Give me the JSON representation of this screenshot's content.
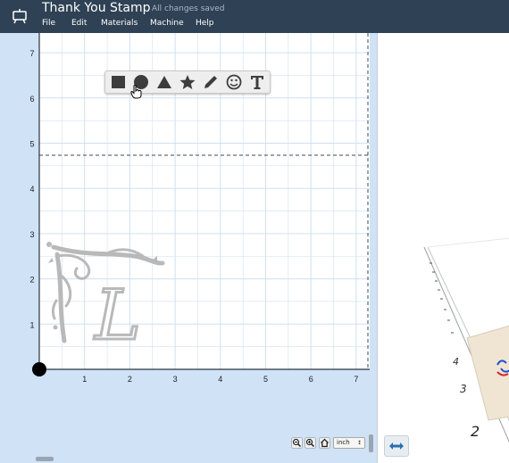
{
  "app": {
    "icon": "robot-icon",
    "title": "Thank You Stamp",
    "save_status": "All changes saved"
  },
  "menu": [
    {
      "label": "File"
    },
    {
      "label": "Edit"
    },
    {
      "label": "Materials"
    },
    {
      "label": "Machine"
    },
    {
      "label": "Help"
    }
  ],
  "toolbar": {
    "tools": [
      {
        "name": "rectangle-tool",
        "icon": "square-icon"
      },
      {
        "name": "circle-tool",
        "icon": "circle-icon"
      },
      {
        "name": "triangle-tool",
        "icon": "triangle-icon"
      },
      {
        "name": "star-tool",
        "icon": "star-icon"
      },
      {
        "name": "pen-tool",
        "icon": "pencil-icon"
      },
      {
        "name": "clipart-tool",
        "icon": "smiley-icon"
      },
      {
        "name": "text-tool",
        "icon": "text-t-icon"
      }
    ]
  },
  "canvas": {
    "x_ticks": [
      "1",
      "2",
      "3",
      "4",
      "5",
      "6",
      "7"
    ],
    "y_ticks": [
      "1",
      "2",
      "3",
      "4",
      "5",
      "6",
      "7"
    ],
    "design_letter": "L"
  },
  "zoom": {
    "unit": "inch",
    "unit_options": [
      "inch"
    ]
  },
  "preview": {
    "ruler_labels": [
      "4",
      "3",
      "2"
    ]
  },
  "colors": {
    "header_bg": "#2f4154",
    "canvas_bg": "#ffffff",
    "margin_bg": "#cfe2f6",
    "grid": "#cfe0f2",
    "design": "#b9b9b9"
  }
}
